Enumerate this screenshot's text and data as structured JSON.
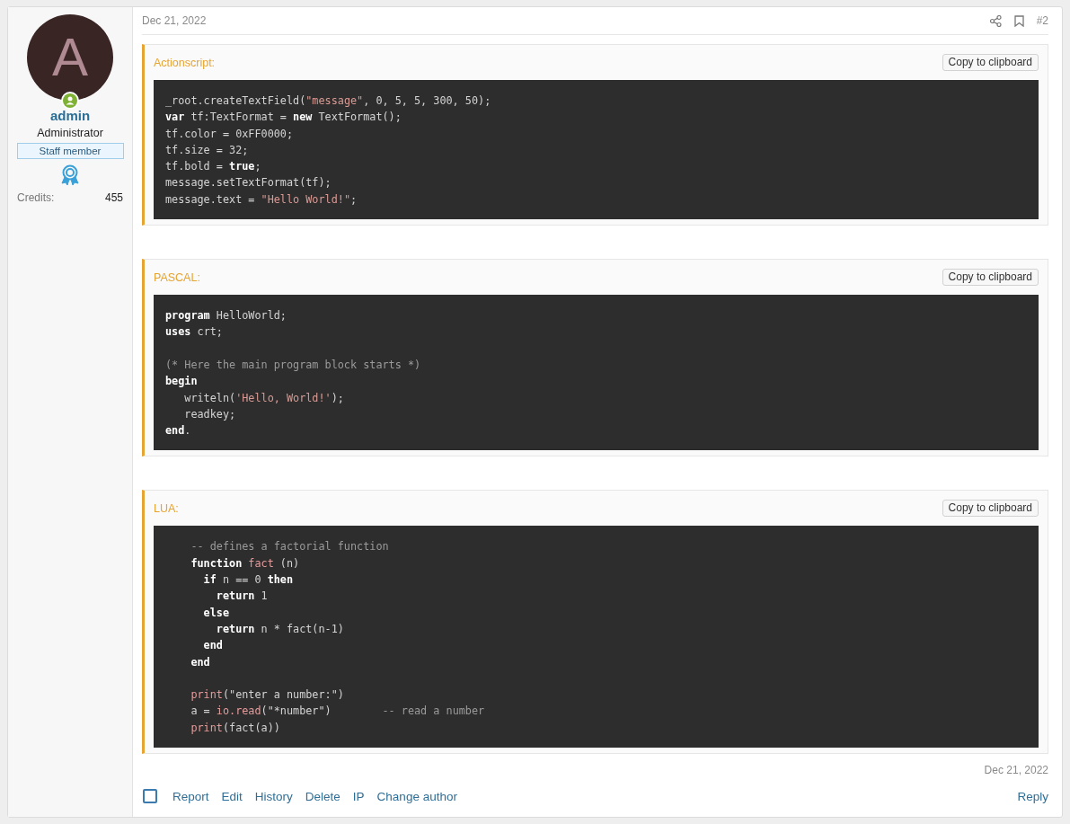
{
  "post": {
    "date": "Dec 21, 2022",
    "number": "#2"
  },
  "user": {
    "avatar_letter": "A",
    "online": true,
    "name": "admin",
    "title": "Administrator",
    "banner": "Staff member",
    "credits_label": "Credits:",
    "credits": "455"
  },
  "code_blocks": [
    {
      "language": "Actionscript:",
      "copy_button": "Copy to clipboard",
      "lines": [
        {
          "kind": "code",
          "tokens": [
            {
              "kind": "plain",
              "text": "_root.createTextField("
            },
            {
              "kind": "string",
              "text": "\"message\""
            },
            {
              "kind": "plain",
              "text": ", 0, 5, 5, 300, 50);"
            }
          ]
        },
        {
          "kind": "code",
          "tokens": [
            {
              "kind": "keyword",
              "text": "var"
            },
            {
              "kind": "plain",
              "text": " tf:TextFormat = "
            },
            {
              "kind": "keyword",
              "text": "new"
            },
            {
              "kind": "plain",
              "text": " TextFormat();"
            }
          ]
        },
        {
          "kind": "code",
          "tokens": [
            {
              "kind": "plain",
              "text": "tf.color = 0xFF0000;"
            }
          ]
        },
        {
          "kind": "code",
          "tokens": [
            {
              "kind": "plain",
              "text": "tf.size = 32;"
            }
          ]
        },
        {
          "kind": "code",
          "tokens": [
            {
              "kind": "plain",
              "text": "tf.bold = "
            },
            {
              "kind": "keyword",
              "text": "true"
            },
            {
              "kind": "plain",
              "text": ";"
            }
          ]
        },
        {
          "kind": "code",
          "tokens": [
            {
              "kind": "plain",
              "text": "message.setTextFormat(tf);"
            }
          ]
        },
        {
          "kind": "code",
          "tokens": [
            {
              "kind": "plain",
              "text": "message.text = "
            },
            {
              "kind": "string",
              "text": "\"Hello World!\""
            },
            {
              "kind": "plain",
              "text": ";"
            }
          ]
        }
      ]
    },
    {
      "language": "PASCAL:",
      "copy_button": "Copy to clipboard",
      "lines": [
        {
          "kind": "code",
          "tokens": [
            {
              "kind": "keyword",
              "text": "program"
            },
            {
              "kind": "plain",
              "text": " HelloWorld;"
            }
          ]
        },
        {
          "kind": "code",
          "tokens": [
            {
              "kind": "keyword",
              "text": "uses"
            },
            {
              "kind": "plain",
              "text": " crt;"
            }
          ]
        },
        {
          "kind": "blank"
        },
        {
          "kind": "code",
          "tokens": [
            {
              "kind": "comment",
              "text": "(* Here the main program block starts *)"
            }
          ]
        },
        {
          "kind": "code",
          "tokens": [
            {
              "kind": "keyword",
              "text": "begin"
            }
          ]
        },
        {
          "kind": "code",
          "tokens": [
            {
              "kind": "plain",
              "text": "   writeln("
            },
            {
              "kind": "string",
              "text": "'Hello, World!'"
            },
            {
              "kind": "plain",
              "text": ");"
            }
          ]
        },
        {
          "kind": "code",
          "tokens": [
            {
              "kind": "plain",
              "text": "   readkey;"
            }
          ]
        },
        {
          "kind": "code",
          "tokens": [
            {
              "kind": "keyword",
              "text": "end"
            },
            {
              "kind": "plain",
              "text": "."
            }
          ]
        }
      ]
    },
    {
      "language": "LUA:",
      "copy_button": "Copy to clipboard",
      "lines": [
        {
          "kind": "code",
          "tokens": [
            {
              "kind": "comment",
              "text": "    -- defines a factorial function"
            }
          ]
        },
        {
          "kind": "code",
          "tokens": [
            {
              "kind": "keyword",
              "text": "    function"
            },
            {
              "kind": "function",
              "text": " fact"
            },
            {
              "kind": "plain",
              "text": " (n)"
            }
          ]
        },
        {
          "kind": "code",
          "tokens": [
            {
              "kind": "keyword",
              "text": "      if"
            },
            {
              "kind": "plain",
              "text": " n == 0 "
            },
            {
              "kind": "keyword",
              "text": "then"
            }
          ]
        },
        {
          "kind": "code",
          "tokens": [
            {
              "kind": "keyword",
              "text": "        return"
            },
            {
              "kind": "plain",
              "text": " 1"
            }
          ]
        },
        {
          "kind": "code",
          "tokens": [
            {
              "kind": "keyword",
              "text": "      else"
            }
          ]
        },
        {
          "kind": "code",
          "tokens": [
            {
              "kind": "keyword",
              "text": "        return"
            },
            {
              "kind": "plain",
              "text": " n * fact(n-1)"
            }
          ]
        },
        {
          "kind": "code",
          "tokens": [
            {
              "kind": "keyword",
              "text": "      end"
            }
          ]
        },
        {
          "kind": "code",
          "tokens": [
            {
              "kind": "keyword",
              "text": "    end"
            }
          ]
        },
        {
          "kind": "blank"
        },
        {
          "kind": "code",
          "tokens": [
            {
              "kind": "function",
              "text": "    print"
            },
            {
              "kind": "plain",
              "text": "(\"enter a number:\")"
            }
          ]
        },
        {
          "kind": "code",
          "tokens": [
            {
              "kind": "plain",
              "text": "    a = "
            },
            {
              "kind": "function",
              "text": "io.read"
            },
            {
              "kind": "plain",
              "text": "(\"*number\")"
            },
            {
              "kind": "comment",
              "text": "        -- read a number"
            }
          ]
        },
        {
          "kind": "code",
          "tokens": [
            {
              "kind": "function",
              "text": "    print"
            },
            {
              "kind": "plain",
              "text": "(fact(a))"
            }
          ]
        }
      ]
    }
  ],
  "last_edited": "Dec 21, 2022",
  "footer": {
    "select": {
      "checked": false
    },
    "actions": [
      "Report",
      "Edit",
      "History",
      "Delete",
      "IP",
      "Change author"
    ],
    "reply": "Reply"
  }
}
